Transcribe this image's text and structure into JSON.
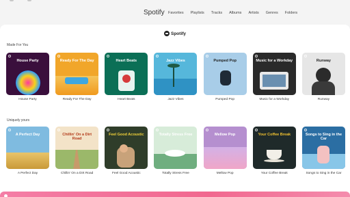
{
  "app": {
    "title": "Spotify"
  },
  "nav": {
    "items": [
      "Favorites",
      "Playlists",
      "Tracks",
      "Albums",
      "Artists",
      "Genres",
      "Folders"
    ]
  },
  "brand": {
    "name": "Spotify"
  },
  "sections": [
    {
      "title": "Made For You",
      "cards": [
        {
          "cover_title": "House Party",
          "label": "House Party",
          "bg": "#3a0f3c",
          "text_color": "#ffffff"
        },
        {
          "cover_title": "Ready For The Day",
          "label": "Ready For The Day",
          "bg": "#f1a62a",
          "text_color": "#ffffff"
        },
        {
          "cover_title": "Heart Beats",
          "label": "Heart Beats",
          "bg": "#0b6f56",
          "text_color": "#ffffff"
        },
        {
          "cover_title": "Jazz Vibes",
          "label": "Jazz Vibes",
          "bg": "#56b7db",
          "text_color": "#ffffff"
        },
        {
          "cover_title": "Pumped Pop",
          "label": "Pumped Pop",
          "bg": "#a8cde8",
          "text_color": "#222222"
        },
        {
          "cover_title": "Music for a Workday",
          "label": "Music for a Workday",
          "bg": "#2a2a2a",
          "text_color": "#ffffff"
        },
        {
          "cover_title": "Runway",
          "label": "Runway",
          "bg": "#e6e6e6",
          "text_color": "#222222"
        }
      ]
    },
    {
      "title": "Uniquely yours",
      "cards": [
        {
          "cover_title": "A Perfect Day",
          "label": "A Perfect Day",
          "bg": "#7fbbe0",
          "text_color": "#ffffff"
        },
        {
          "cover_title": "Chillin' On a Dirt Road",
          "label": "Chillin' On a Dirt Road",
          "bg": "#f3e3c8",
          "text_color": "#b23a1a"
        },
        {
          "cover_title": "Feel Good Acoustic",
          "label": "Feel Good Acoustic",
          "bg": "#2f3d2a",
          "text_color": "#f2d23a"
        },
        {
          "cover_title": "Totally Stress Free",
          "label": "Totally Stress Free",
          "bg": "#d7ecd9",
          "text_color": "#ffffff"
        },
        {
          "cover_title": "Mellow Pop",
          "label": "Mellow Pop",
          "bg": "#b58fcf",
          "text_color": "#ffffff"
        },
        {
          "cover_title": "Your Coffee Break",
          "label": "Your Coffee Break",
          "bg": "#1f2a2a",
          "text_color": "#f2c230"
        },
        {
          "cover_title": "Songs to Sing in the Car",
          "label": "Songs to Sing in the Car",
          "bg": "#2b6ea3",
          "text_color": "#ffffff"
        }
      ]
    }
  ]
}
